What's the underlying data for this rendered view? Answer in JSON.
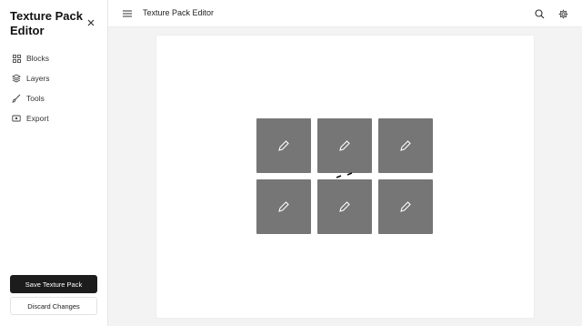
{
  "sidebar": {
    "brand": "Texture Pack Editor",
    "items": [
      {
        "label": "Blocks",
        "icon": "blocks-icon"
      },
      {
        "label": "Layers",
        "icon": "layers-icon"
      },
      {
        "label": "Tools",
        "icon": "brush-icon"
      },
      {
        "label": "Export",
        "icon": "export-icon"
      }
    ],
    "save_label": "Save Texture Pack",
    "discard_label": "Discard Changes"
  },
  "header": {
    "title": "Texture Pack Editor"
  },
  "canvas": {
    "tiles": [
      {
        "icon": "pencil-icon"
      },
      {
        "icon": "pencil-icon"
      },
      {
        "icon": "pencil-icon"
      },
      {
        "icon": "pencil-icon"
      },
      {
        "icon": "pencil-icon"
      },
      {
        "icon": "pencil-icon"
      }
    ],
    "tile_color": "#767676"
  },
  "colors": {
    "primary_button": "#1c1c1c",
    "background": "#f3f3f3"
  }
}
